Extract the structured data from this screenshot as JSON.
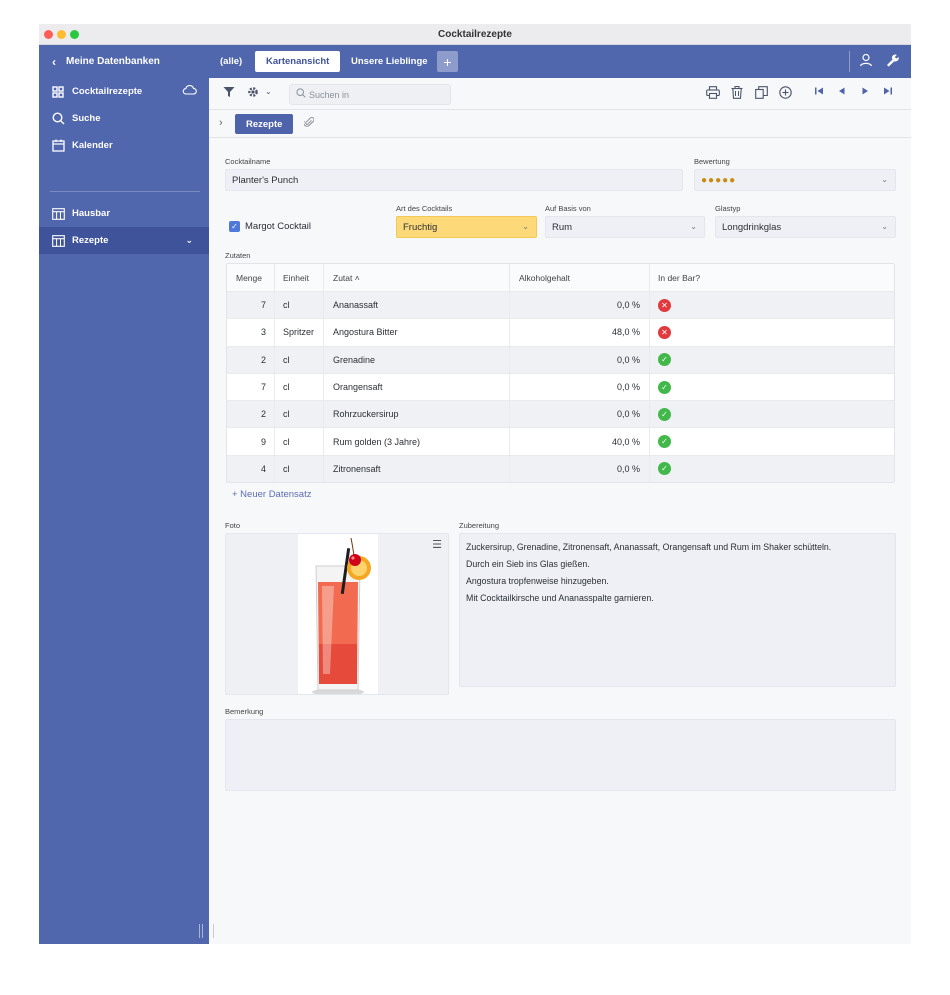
{
  "window": {
    "title": "Cocktailrezepte"
  },
  "sidebar": {
    "back_label": "Meine Datenbanken",
    "items": [
      {
        "label": "Cocktailrezepte",
        "icon": "grid-icon"
      },
      {
        "label": "Suche",
        "icon": "search-icon"
      },
      {
        "label": "Kalender",
        "icon": "calendar-icon"
      },
      {
        "label": "Hausbar",
        "icon": "table-icon"
      },
      {
        "label": "Rezepte",
        "icon": "table-icon"
      }
    ]
  },
  "tabs": [
    {
      "label": "(alle)"
    },
    {
      "label": "Kartenansicht"
    },
    {
      "label": "Unsere Lieblinge"
    }
  ],
  "toolbar": {
    "search_placeholder": "Suchen in"
  },
  "subtabs": {
    "active": "Rezepte"
  },
  "form": {
    "cocktailname_label": "Cocktailname",
    "cocktailname_value": "Planter's Punch",
    "bewertung_label": "Bewertung",
    "bewertung_value": "●●●●●",
    "margot_label": "Margot Cocktail",
    "art_label": "Art des Cocktails",
    "art_value": "Fruchtig",
    "basis_label": "Auf Basis von",
    "basis_value": "Rum",
    "glas_label": "Glastyp",
    "glas_value": "Longdrinkglas",
    "zutaten_label": "Zutaten",
    "foto_label": "Foto",
    "zubereitung_label": "Zubereitung",
    "bemerkung_label": "Bemerkung",
    "new_record_label": "+  Neuer Datensatz"
  },
  "table": {
    "headers": [
      "Menge",
      "Einheit",
      "Zutat ˄",
      "Alkoholgehalt",
      "In der Bar?"
    ],
    "rows": [
      {
        "menge": "7",
        "einheit": "cl",
        "zutat": "Ananassaft",
        "alkohol": "0,0 %",
        "in_bar": false
      },
      {
        "menge": "3",
        "einheit": "Spritzer",
        "zutat": "Angostura Bitter",
        "alkohol": "48,0 %",
        "in_bar": false
      },
      {
        "menge": "2",
        "einheit": "cl",
        "zutat": "Grenadine",
        "alkohol": "0,0 %",
        "in_bar": true
      },
      {
        "menge": "7",
        "einheit": "cl",
        "zutat": "Orangensaft",
        "alkohol": "0,0 %",
        "in_bar": true
      },
      {
        "menge": "2",
        "einheit": "cl",
        "zutat": "Rohrzuckersirup",
        "alkohol": "0,0 %",
        "in_bar": true
      },
      {
        "menge": "9",
        "einheit": "cl",
        "zutat": "Rum golden (3 Jahre)",
        "alkohol": "40,0 %",
        "in_bar": true
      },
      {
        "menge": "4",
        "einheit": "cl",
        "zutat": "Zitronensaft",
        "alkohol": "0,0 %",
        "in_bar": true
      }
    ]
  },
  "zubereitung": [
    "Zuckersirup, Grenadine, Zitronensaft, Ananassaft, Orangensaft und Rum im Shaker schütteln.",
    "Durch ein Sieb ins Glas gießen.",
    "Angostura tropfenweise hinzugeben.",
    "Mit Cocktailkirsche und Ananasspalte garnieren."
  ],
  "colors": {
    "accent": "#5066ad",
    "accent_dark": "#3f539a",
    "highlight": "#fdd97a",
    "status_yes": "#43b84a",
    "status_no": "#e0393e"
  }
}
